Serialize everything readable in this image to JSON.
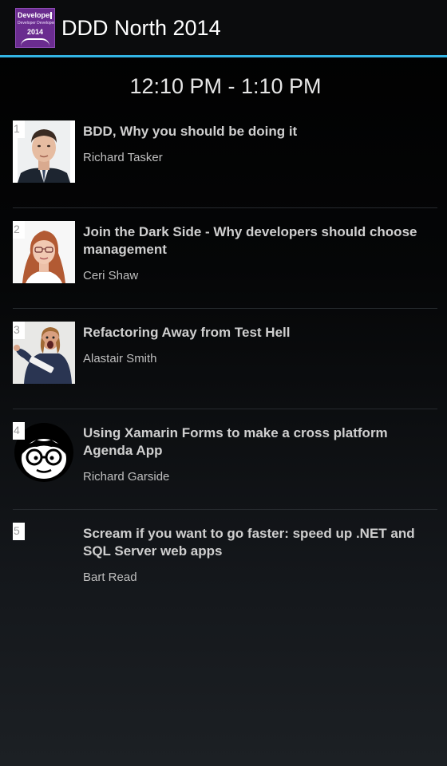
{
  "app": {
    "title": "DDD North 2014",
    "logo": {
      "line1": "Developer",
      "line2": "Developer Developer",
      "year": "2014"
    },
    "accent_color": "#33b5e5"
  },
  "timeslot": "12:10 PM - 1:10 PM",
  "sessions": [
    {
      "number": "1",
      "title": "BDD, Why you should be doing it",
      "speaker": "Richard Tasker"
    },
    {
      "number": "2",
      "title": "Join the Dark Side - Why developers should choose management",
      "speaker": "Ceri Shaw"
    },
    {
      "number": "3",
      "title": "Refactoring Away from Test Hell",
      "speaker": "Alastair Smith"
    },
    {
      "number": "4",
      "title": "Using Xamarin Forms to make a cross platform Agenda App",
      "speaker": "Richard Garside"
    },
    {
      "number": "5",
      "title": "Scream if you want to go faster: speed up .NET and SQL Server web apps",
      "speaker": "Bart Read"
    }
  ]
}
